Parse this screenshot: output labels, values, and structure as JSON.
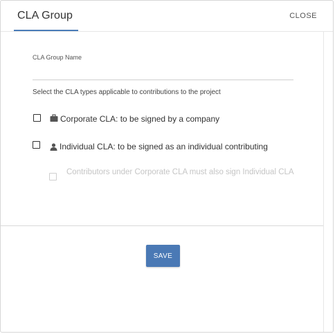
{
  "dialog": {
    "title": "CLA Group",
    "close_label": "CLOSE",
    "name_label": "CLA Group Name",
    "name_value": "",
    "instructions": "Select the CLA types applicable to contributions to the project",
    "options": [
      {
        "label": "Corporate CLA: to be signed by a company",
        "icon": "briefcase-icon",
        "checked": false
      },
      {
        "label": "Individual CLA: to be signed as an individual contributing",
        "icon": "person-icon",
        "checked": false
      },
      {
        "label": "Contributors under Corporate CLA must also sign Individual CLA",
        "checked": false,
        "disabled": true
      }
    ],
    "save_label": "SAVE"
  },
  "colors": {
    "accent": "#4a79b5",
    "text": "#333333",
    "disabled_text": "#c5c5c5",
    "divider": "#d9d9d9"
  }
}
